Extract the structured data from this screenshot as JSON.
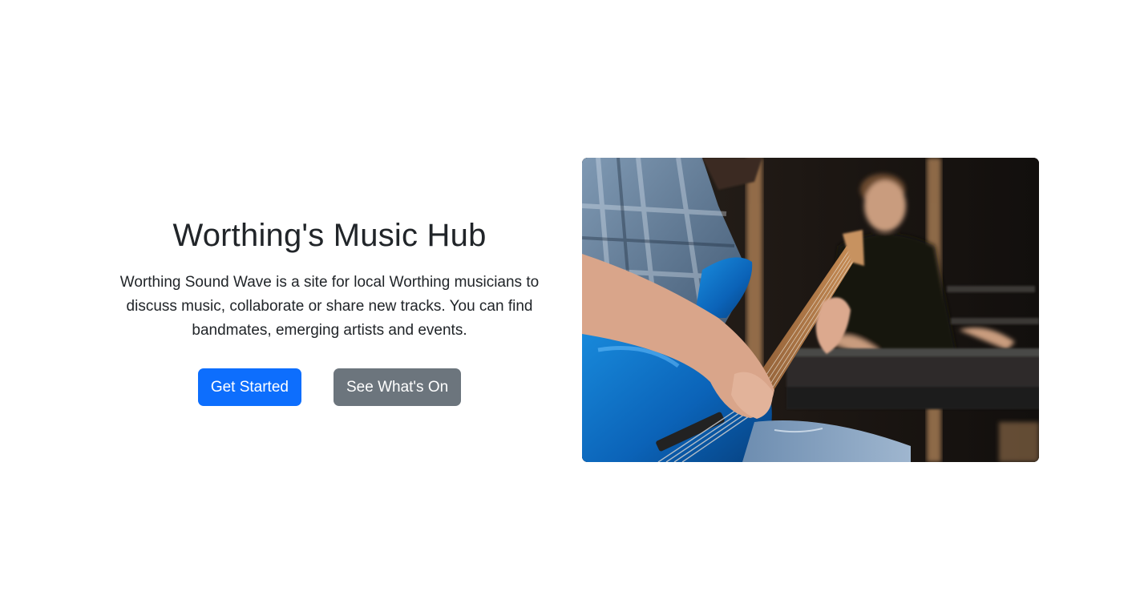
{
  "hero": {
    "title": "Worthing's Music Hub",
    "description": "Worthing Sound Wave is a site for local Worthing musicians to discuss music, collaborate or share new tracks. You can find bandmates, emerging artists and events.",
    "primary_button": "Get Started",
    "secondary_button": "See What's On",
    "image": {
      "subject": "bass-guitarist-and-keyboard-player-photo"
    }
  },
  "colors": {
    "primary": "#0d6efd",
    "secondary": "#6c757d",
    "text": "#212529",
    "background": "#ffffff"
  }
}
